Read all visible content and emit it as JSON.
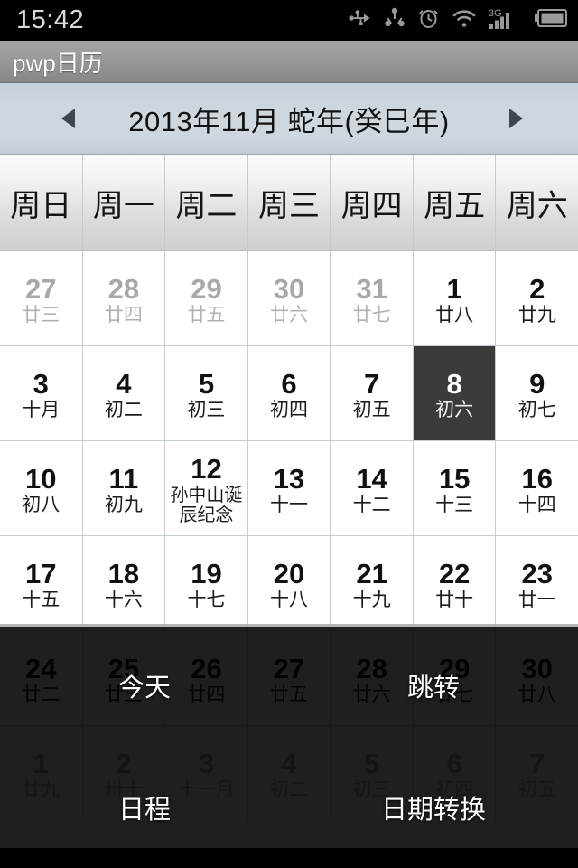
{
  "statusbar": {
    "time": "15:42",
    "icons": [
      "usb-icon",
      "share-icon",
      "alarm-icon",
      "wifi-icon",
      "signal-3g-icon",
      "battery-icon"
    ],
    "network_label": "3G"
  },
  "titlebar": {
    "app_title": "pwp日历"
  },
  "monthbar": {
    "title": "2013年11月  蛇年(癸巳年)",
    "prev_label": "◀",
    "next_label": "▶"
  },
  "weekdays": [
    "周日",
    "周一",
    "周二",
    "周三",
    "周四",
    "周五",
    "周六"
  ],
  "calendar": {
    "selected_day": 8,
    "rows": [
      [
        {
          "d": "27",
          "l": "廿三",
          "o": true
        },
        {
          "d": "28",
          "l": "廿四",
          "o": true
        },
        {
          "d": "29",
          "l": "廿五",
          "o": true
        },
        {
          "d": "30",
          "l": "廿六",
          "o": true
        },
        {
          "d": "31",
          "l": "廿七",
          "o": true
        },
        {
          "d": "1",
          "l": "廿八",
          "o": false
        },
        {
          "d": "2",
          "l": "廿九",
          "o": false
        }
      ],
      [
        {
          "d": "3",
          "l": "十月",
          "o": false
        },
        {
          "d": "4",
          "l": "初二",
          "o": false
        },
        {
          "d": "5",
          "l": "初三",
          "o": false
        },
        {
          "d": "6",
          "l": "初四",
          "o": false
        },
        {
          "d": "7",
          "l": "初五",
          "o": false
        },
        {
          "d": "8",
          "l": "初六",
          "o": false,
          "s": true
        },
        {
          "d": "9",
          "l": "初七",
          "o": false
        }
      ],
      [
        {
          "d": "10",
          "l": "初八",
          "o": false
        },
        {
          "d": "11",
          "l": "初九",
          "o": false
        },
        {
          "d": "12",
          "l": "孙中山诞辰纪念",
          "o": false,
          "f": true
        },
        {
          "d": "13",
          "l": "十一",
          "o": false
        },
        {
          "d": "14",
          "l": "十二",
          "o": false
        },
        {
          "d": "15",
          "l": "十三",
          "o": false
        },
        {
          "d": "16",
          "l": "十四",
          "o": false
        }
      ],
      [
        {
          "d": "17",
          "l": "十五",
          "o": false
        },
        {
          "d": "18",
          "l": "十六",
          "o": false
        },
        {
          "d": "19",
          "l": "十七",
          "o": false
        },
        {
          "d": "20",
          "l": "十八",
          "o": false
        },
        {
          "d": "21",
          "l": "十九",
          "o": false
        },
        {
          "d": "22",
          "l": "廿十",
          "o": false
        },
        {
          "d": "23",
          "l": "廿一",
          "o": false
        }
      ],
      [
        {
          "d": "24",
          "l": "廿二",
          "o": false
        },
        {
          "d": "25",
          "l": "廿三",
          "o": false
        },
        {
          "d": "26",
          "l": "廿四",
          "o": false
        },
        {
          "d": "27",
          "l": "廿五",
          "o": false
        },
        {
          "d": "28",
          "l": "廿六",
          "o": false
        },
        {
          "d": "29",
          "l": "廿七",
          "o": false
        },
        {
          "d": "30",
          "l": "廿八",
          "o": false
        }
      ],
      [
        {
          "d": "1",
          "l": "廿九",
          "o": true
        },
        {
          "d": "2",
          "l": "卅十",
          "o": true
        },
        {
          "d": "3",
          "l": "十一月",
          "o": true
        },
        {
          "d": "4",
          "l": "初二",
          "o": true
        },
        {
          "d": "5",
          "l": "初三",
          "o": true
        },
        {
          "d": "6",
          "l": "初四",
          "o": true
        },
        {
          "d": "7",
          "l": "初五",
          "o": true
        }
      ]
    ]
  },
  "menu": {
    "items": [
      {
        "label": "今天",
        "name": "menu-today"
      },
      {
        "label": "跳转",
        "name": "menu-goto"
      },
      {
        "label": "日程",
        "name": "menu-schedule"
      },
      {
        "label": "日期转换",
        "name": "menu-date-convert"
      }
    ]
  },
  "colors": {
    "statusbar_bg": "#000000",
    "titlebar_bg": "#9a9a9a",
    "monthbar_bg": "#ced7df",
    "selected_day_bg": "#3b3b3b",
    "grid_line": "#c4ccd6"
  }
}
